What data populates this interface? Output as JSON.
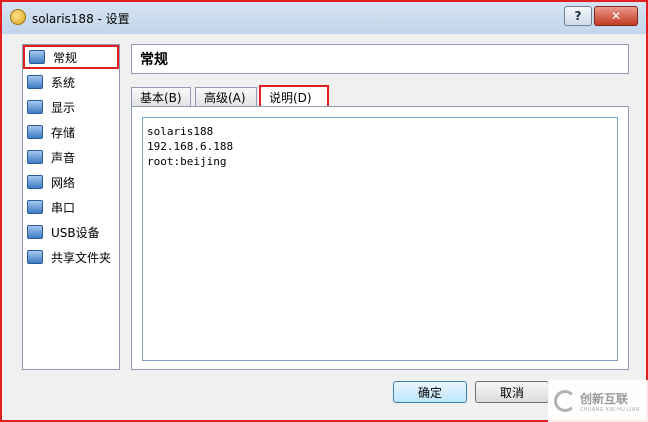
{
  "window": {
    "title": "solaris188 - 设置",
    "help_label": "?",
    "close_label": "✕"
  },
  "sidebar": {
    "items": [
      {
        "label": "常规",
        "icon": "monitor-icon"
      },
      {
        "label": "系统",
        "icon": "chip-icon"
      },
      {
        "label": "显示",
        "icon": "display-icon"
      },
      {
        "label": "存储",
        "icon": "storage-icon"
      },
      {
        "label": "声音",
        "icon": "speaker-icon"
      },
      {
        "label": "网络",
        "icon": "network-icon"
      },
      {
        "label": "串口",
        "icon": "serial-port-icon"
      },
      {
        "label": "USB设备",
        "icon": "usb-icon"
      },
      {
        "label": "共享文件夹",
        "icon": "folder-icon"
      }
    ]
  },
  "main": {
    "section_title": "常规",
    "tabs": [
      {
        "label": "基本(B)"
      },
      {
        "label": "高级(A)"
      },
      {
        "label": "说明(D)"
      }
    ],
    "description": "solaris188\n192.168.6.188\nroot:beijing"
  },
  "buttons": {
    "ok_label": "确定",
    "cancel_label": "取消"
  },
  "watermark": {
    "cn": "创新互联",
    "en": "CHUANG XIN HU LIAN"
  },
  "colors": {
    "highlight": "#e02020",
    "accent": "#3f7bc4"
  }
}
